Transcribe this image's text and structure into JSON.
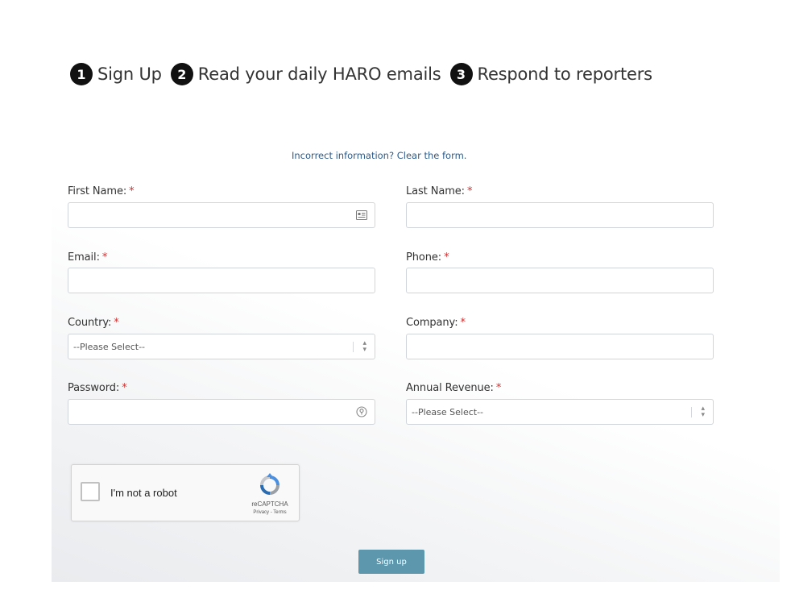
{
  "steps": [
    {
      "number": "1",
      "label": "Sign Up"
    },
    {
      "number": "2",
      "label": "Read your daily HARO emails"
    },
    {
      "number": "3",
      "label": "Respond to reporters"
    }
  ],
  "form": {
    "clear_link": "Incorrect information? Clear the form.",
    "required_marker": "*",
    "first_name": {
      "label": "First Name:",
      "value": ""
    },
    "last_name": {
      "label": "Last Name:",
      "value": ""
    },
    "email": {
      "label": "Email:",
      "value": ""
    },
    "phone": {
      "label": "Phone:",
      "value": ""
    },
    "country": {
      "label": "Country:",
      "selected": "--Please Select--"
    },
    "company": {
      "label": "Company:",
      "value": ""
    },
    "password": {
      "label": "Password:",
      "value": ""
    },
    "annual_revenue": {
      "label": "Annual Revenue:",
      "selected": "--Please Select--"
    }
  },
  "captcha": {
    "label": "I'm not a robot",
    "brand": "reCAPTCHA",
    "links": "Privacy - Terms",
    "icon": "recaptcha-logo-icon"
  },
  "submit": {
    "label": "Sign up"
  },
  "colors": {
    "required": "#d32f2f",
    "link": "#2c5a8a",
    "button": "#5c97ad",
    "step_badge": "#111111"
  }
}
